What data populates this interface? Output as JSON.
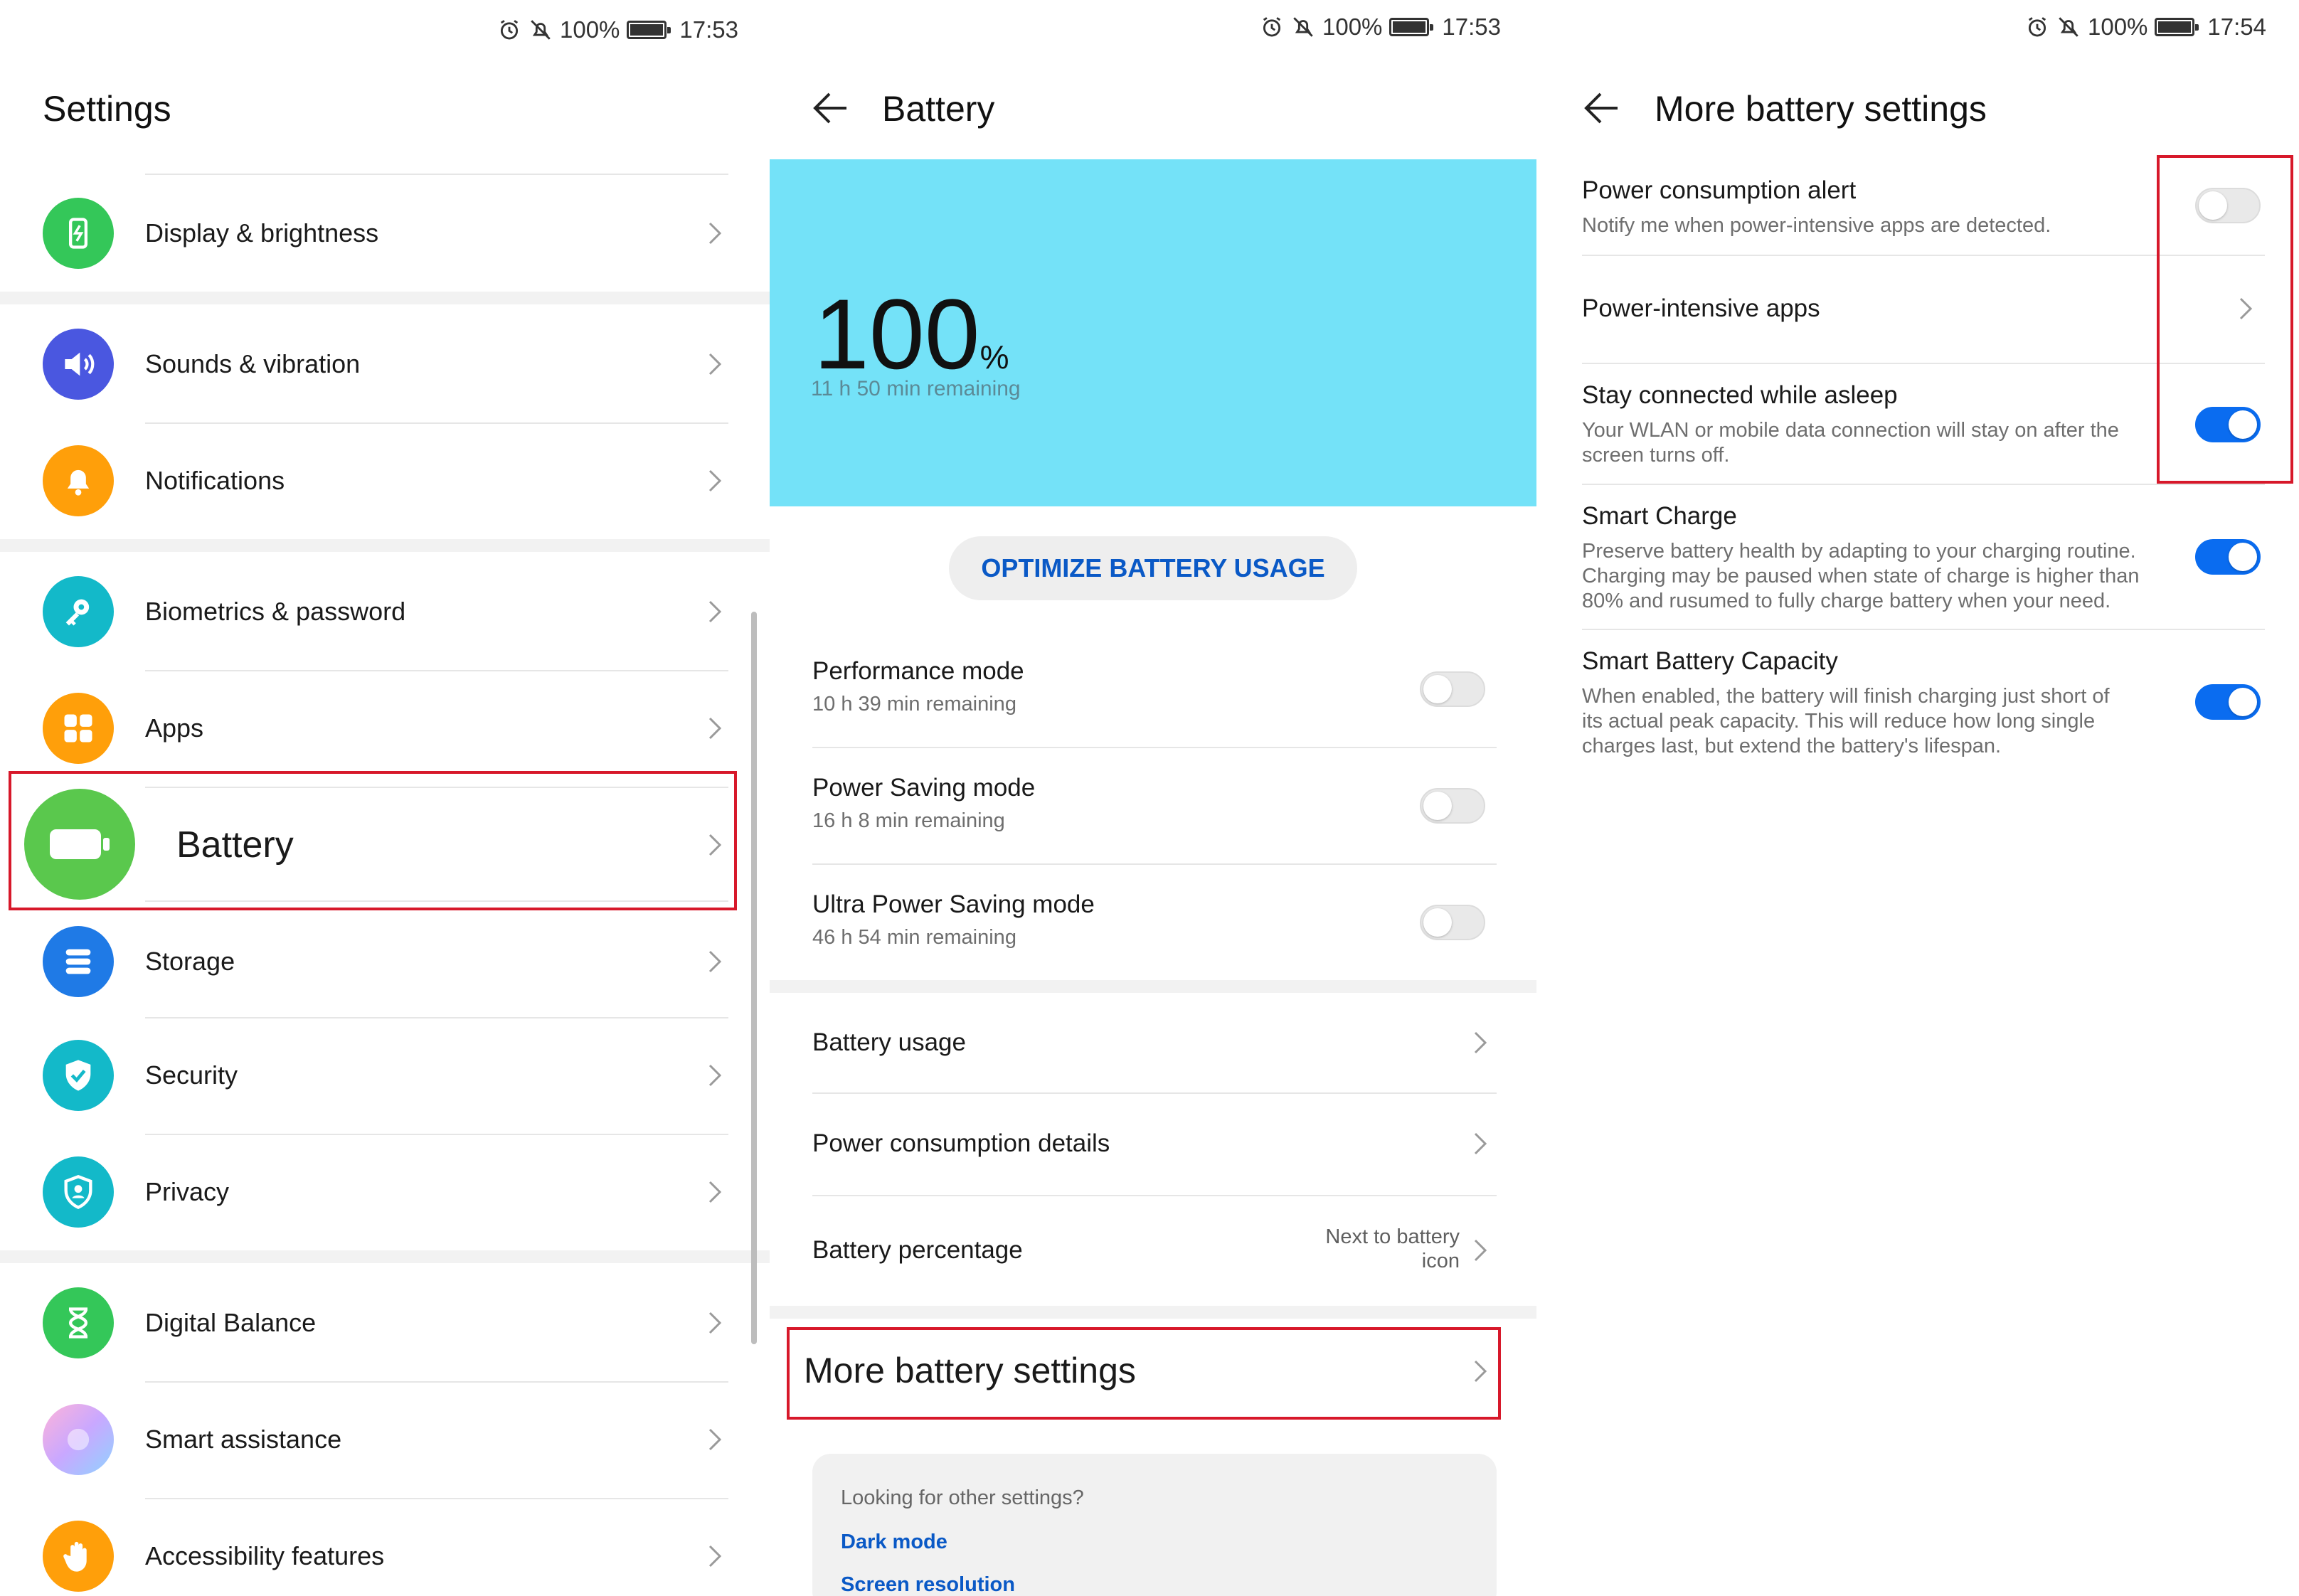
{
  "status_bar": [
    {
      "battery_pct": "100%",
      "time": "17:53"
    },
    {
      "battery_pct": "100%",
      "time": "17:53"
    },
    {
      "battery_pct": "100%",
      "time": "17:54"
    }
  ],
  "settings": {
    "title": "Settings",
    "items": [
      {
        "label": "Display & brightness",
        "icon": "display-icon",
        "color": "#34c759"
      },
      {
        "label": "Sounds & vibration",
        "icon": "speaker-icon",
        "color": "#4a57e0"
      },
      {
        "label": "Notifications",
        "icon": "bell-icon",
        "color": "#ff9f0a"
      },
      {
        "label": "Biometrics & password",
        "icon": "key-icon",
        "color": "#13b9c9"
      },
      {
        "label": "Apps",
        "icon": "apps-grid-icon",
        "color": "#ff9f0a"
      },
      {
        "label": "Battery",
        "icon": "battery-icon",
        "color": "#5ac84d"
      },
      {
        "label": "Storage",
        "icon": "storage-icon",
        "color": "#1f7ae6"
      },
      {
        "label": "Security",
        "icon": "shield-check-icon",
        "color": "#13b9c9"
      },
      {
        "label": "Privacy",
        "icon": "privacy-shield-icon",
        "color": "#13b9c9"
      },
      {
        "label": "Digital Balance",
        "icon": "hourglass-icon",
        "color": "#34c759"
      },
      {
        "label": "Smart assistance",
        "icon": "smart-assistance-icon",
        "color": "#c9a8ff"
      },
      {
        "label": "Accessibility features",
        "icon": "hand-icon",
        "color": "#ff9f0a"
      }
    ]
  },
  "battery": {
    "title": "Battery",
    "percent": "100",
    "percent_unit": "%",
    "remaining": "11 h 50 min remaining",
    "optimize_label": "OPTIMIZE BATTERY USAGE",
    "modes": [
      {
        "title": "Performance mode",
        "sub": "10 h 39 min remaining",
        "on": false
      },
      {
        "title": "Power Saving mode",
        "sub": "16 h 8 min remaining",
        "on": false
      },
      {
        "title": "Ultra Power Saving mode",
        "sub": "46 h 54 min remaining",
        "on": false
      }
    ],
    "links": [
      {
        "title": "Battery usage"
      },
      {
        "title": "Power consumption details"
      },
      {
        "title": "Battery percentage",
        "value_line1": "Next to battery",
        "value_line2": "icon"
      }
    ],
    "more_label": "More battery settings",
    "card": {
      "heading": "Looking for other settings?",
      "link1": "Dark mode",
      "link2": "Screen resolution"
    }
  },
  "more": {
    "title": "More battery settings",
    "items": [
      {
        "title": "Power consumption alert",
        "desc": [
          "Notify me when power-intensive apps are detected."
        ],
        "control": "toggle",
        "on": false
      },
      {
        "title": "Power-intensive apps",
        "desc": [],
        "control": "chevron"
      },
      {
        "title": "Stay connected while asleep",
        "desc": [
          "Your WLAN or mobile data connection will stay on after the",
          "screen turns off."
        ],
        "control": "toggle",
        "on": true
      },
      {
        "title": "Smart Charge",
        "desc": [
          "Preserve battery health by adapting to your charging routine.",
          "Charging may be paused when state of charge is higher than",
          "80% and rusumed to fully charge battery when your need."
        ],
        "control": "toggle",
        "on": true
      },
      {
        "title": "Smart Battery Capacity",
        "desc": [
          "When enabled, the battery will finish charging just short of",
          "its actual peak capacity. This will reduce how long single",
          "charges last, but extend the battery's lifespan."
        ],
        "control": "toggle",
        "on": true
      }
    ]
  },
  "colors": {
    "accent": "#0a6cf0",
    "highlight": "#d7182a",
    "hero": "#74e2f8"
  }
}
